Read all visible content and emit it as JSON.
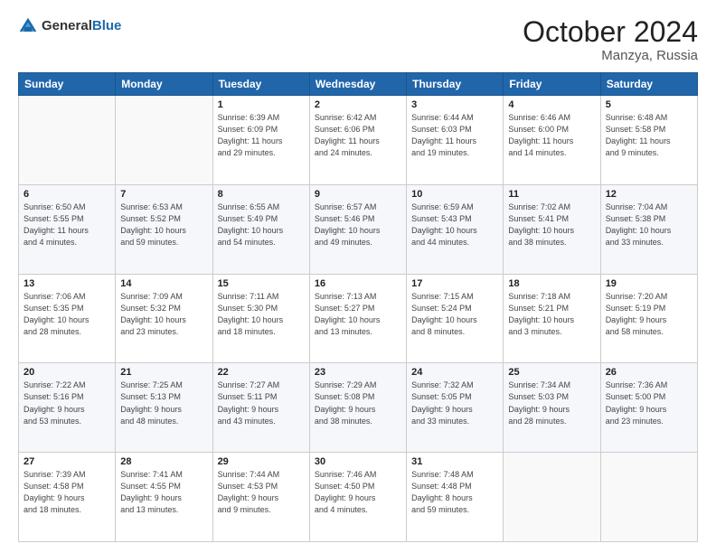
{
  "header": {
    "logo": {
      "general": "General",
      "blue": "Blue"
    },
    "title": "October 2024",
    "location": "Manzya, Russia"
  },
  "weekdays": [
    "Sunday",
    "Monday",
    "Tuesday",
    "Wednesday",
    "Thursday",
    "Friday",
    "Saturday"
  ],
  "weeks": [
    [
      {
        "day": "",
        "info": ""
      },
      {
        "day": "",
        "info": ""
      },
      {
        "day": "1",
        "info": "Sunrise: 6:39 AM\nSunset: 6:09 PM\nDaylight: 11 hours\nand 29 minutes."
      },
      {
        "day": "2",
        "info": "Sunrise: 6:42 AM\nSunset: 6:06 PM\nDaylight: 11 hours\nand 24 minutes."
      },
      {
        "day": "3",
        "info": "Sunrise: 6:44 AM\nSunset: 6:03 PM\nDaylight: 11 hours\nand 19 minutes."
      },
      {
        "day": "4",
        "info": "Sunrise: 6:46 AM\nSunset: 6:00 PM\nDaylight: 11 hours\nand 14 minutes."
      },
      {
        "day": "5",
        "info": "Sunrise: 6:48 AM\nSunset: 5:58 PM\nDaylight: 11 hours\nand 9 minutes."
      }
    ],
    [
      {
        "day": "6",
        "info": "Sunrise: 6:50 AM\nSunset: 5:55 PM\nDaylight: 11 hours\nand 4 minutes."
      },
      {
        "day": "7",
        "info": "Sunrise: 6:53 AM\nSunset: 5:52 PM\nDaylight: 10 hours\nand 59 minutes."
      },
      {
        "day": "8",
        "info": "Sunrise: 6:55 AM\nSunset: 5:49 PM\nDaylight: 10 hours\nand 54 minutes."
      },
      {
        "day": "9",
        "info": "Sunrise: 6:57 AM\nSunset: 5:46 PM\nDaylight: 10 hours\nand 49 minutes."
      },
      {
        "day": "10",
        "info": "Sunrise: 6:59 AM\nSunset: 5:43 PM\nDaylight: 10 hours\nand 44 minutes."
      },
      {
        "day": "11",
        "info": "Sunrise: 7:02 AM\nSunset: 5:41 PM\nDaylight: 10 hours\nand 38 minutes."
      },
      {
        "day": "12",
        "info": "Sunrise: 7:04 AM\nSunset: 5:38 PM\nDaylight: 10 hours\nand 33 minutes."
      }
    ],
    [
      {
        "day": "13",
        "info": "Sunrise: 7:06 AM\nSunset: 5:35 PM\nDaylight: 10 hours\nand 28 minutes."
      },
      {
        "day": "14",
        "info": "Sunrise: 7:09 AM\nSunset: 5:32 PM\nDaylight: 10 hours\nand 23 minutes."
      },
      {
        "day": "15",
        "info": "Sunrise: 7:11 AM\nSunset: 5:30 PM\nDaylight: 10 hours\nand 18 minutes."
      },
      {
        "day": "16",
        "info": "Sunrise: 7:13 AM\nSunset: 5:27 PM\nDaylight: 10 hours\nand 13 minutes."
      },
      {
        "day": "17",
        "info": "Sunrise: 7:15 AM\nSunset: 5:24 PM\nDaylight: 10 hours\nand 8 minutes."
      },
      {
        "day": "18",
        "info": "Sunrise: 7:18 AM\nSunset: 5:21 PM\nDaylight: 10 hours\nand 3 minutes."
      },
      {
        "day": "19",
        "info": "Sunrise: 7:20 AM\nSunset: 5:19 PM\nDaylight: 9 hours\nand 58 minutes."
      }
    ],
    [
      {
        "day": "20",
        "info": "Sunrise: 7:22 AM\nSunset: 5:16 PM\nDaylight: 9 hours\nand 53 minutes."
      },
      {
        "day": "21",
        "info": "Sunrise: 7:25 AM\nSunset: 5:13 PM\nDaylight: 9 hours\nand 48 minutes."
      },
      {
        "day": "22",
        "info": "Sunrise: 7:27 AM\nSunset: 5:11 PM\nDaylight: 9 hours\nand 43 minutes."
      },
      {
        "day": "23",
        "info": "Sunrise: 7:29 AM\nSunset: 5:08 PM\nDaylight: 9 hours\nand 38 minutes."
      },
      {
        "day": "24",
        "info": "Sunrise: 7:32 AM\nSunset: 5:05 PM\nDaylight: 9 hours\nand 33 minutes."
      },
      {
        "day": "25",
        "info": "Sunrise: 7:34 AM\nSunset: 5:03 PM\nDaylight: 9 hours\nand 28 minutes."
      },
      {
        "day": "26",
        "info": "Sunrise: 7:36 AM\nSunset: 5:00 PM\nDaylight: 9 hours\nand 23 minutes."
      }
    ],
    [
      {
        "day": "27",
        "info": "Sunrise: 7:39 AM\nSunset: 4:58 PM\nDaylight: 9 hours\nand 18 minutes."
      },
      {
        "day": "28",
        "info": "Sunrise: 7:41 AM\nSunset: 4:55 PM\nDaylight: 9 hours\nand 13 minutes."
      },
      {
        "day": "29",
        "info": "Sunrise: 7:44 AM\nSunset: 4:53 PM\nDaylight: 9 hours\nand 9 minutes."
      },
      {
        "day": "30",
        "info": "Sunrise: 7:46 AM\nSunset: 4:50 PM\nDaylight: 9 hours\nand 4 minutes."
      },
      {
        "day": "31",
        "info": "Sunrise: 7:48 AM\nSunset: 4:48 PM\nDaylight: 8 hours\nand 59 minutes."
      },
      {
        "day": "",
        "info": ""
      },
      {
        "day": "",
        "info": ""
      }
    ]
  ]
}
